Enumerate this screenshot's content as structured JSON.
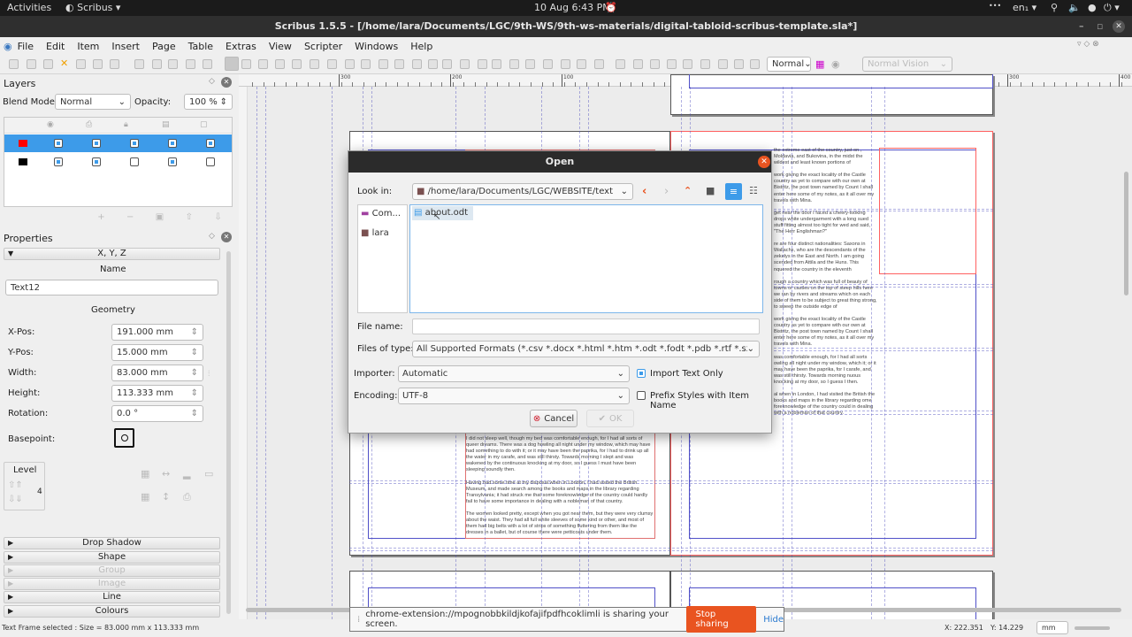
{
  "topbar": {
    "activities": "Activities",
    "app": "Scribus",
    "app_arrow": "▾",
    "clock": "10 Aug  6:43 PM",
    "alarm_icon": "alarm-clock-icon",
    "dots": "•••",
    "lang": "en₁ ▾",
    "tray_icons": [
      "network-icon",
      "volume-icon",
      "microphone-icon",
      "power-icon"
    ]
  },
  "window": {
    "title": "Scribus 1.5.5 - [/home/lara/Documents/LGC/9th-WS/9th-ws-materials/digital-tabloid-scribus-template.sla*]"
  },
  "menu": [
    "File",
    "Edit",
    "Item",
    "Insert",
    "Page",
    "Table",
    "Extras",
    "View",
    "Scripter",
    "Windows",
    "Help"
  ],
  "toolbar": {
    "mode": "Normal",
    "vision": "Normal Vision"
  },
  "ruler": {
    "labels": [
      "300",
      "200",
      "100",
      "0",
      "100",
      "200",
      "300",
      "400"
    ]
  },
  "layers": {
    "title": "Layers",
    "blend_label": "Blend Mode:",
    "blend_value": "Normal",
    "opacity_label": "Opacity:",
    "opacity_value": "100 %",
    "rows": [
      {
        "color": "#ff0000",
        "checks": [
          true,
          true,
          true,
          true,
          true
        ],
        "selected": true
      },
      {
        "color": "#000000",
        "checks": [
          true,
          true,
          false,
          true,
          false
        ],
        "selected": false
      }
    ]
  },
  "properties": {
    "title": "Properties",
    "xyz": "X, Y, Z",
    "name_heading": "Name",
    "name_value": "Text12",
    "geometry": "Geometry",
    "fields": [
      {
        "label": "X-Pos:",
        "value": "191.000 mm"
      },
      {
        "label": "Y-Pos:",
        "value": "15.000 mm"
      },
      {
        "label": "Width:",
        "value": "83.000 mm"
      },
      {
        "label": "Height:",
        "value": "113.333 mm"
      },
      {
        "label": "Rotation:",
        "value": "0.0 °"
      }
    ],
    "basepoint": "Basepoint:",
    "level": "Level",
    "level_value": "4",
    "sections": [
      {
        "label": "Drop Shadow",
        "enabled": true
      },
      {
        "label": "Shape",
        "enabled": true
      },
      {
        "label": "Group",
        "enabled": false
      },
      {
        "label": "Image",
        "enabled": false
      },
      {
        "label": "Line",
        "enabled": true
      },
      {
        "label": "Colours",
        "enabled": true
      }
    ]
  },
  "document": {
    "left_text": [
      "I did not sleep well, though my bed was comfortable enough, for I had all sorts of queer dreams. There was a dog howling all night under my window, which may have had something to do with it; or it may have been the paprika, for I had to drink up all the water in my carafe, and was still thirsty. Towards morning I slept and was wakened by the continuous knocking at my door, so I guess I must have been sleeping soundly then.",
      "Having had some time at my disposal when in London, I had visited the British Museum, and made search among the books and maps in the library regarding Transylvania; it had struck me that some foreknowledge of the country could hardly fail to have some importance in dealing with a nobleman of that country.",
      "The women looked pretty, except when you got near them, but they were very clumsy about the waist. They had all full white sleeves of some kind or other, and most of them had big belts with a lot of strips of something fluttering from them like the dresses in a ballet, but of course there were petticoats under them."
    ],
    "right_text": [
      "the extreme east of the country, just on , Moldavia, and Bukovina, in the midst the wildest and least known portions of",
      "work giving the exact locality of the Castle country as yet to compare with our own at Bistritz, the post town named by Count I shall enter here some of my notes, as it all over my travels with Mina.",
      "get near the door I faced a cheery-looking drops white undergarment with a long sued stuff fitting almost too tight for wed and said, \"The Herr Englishman?\"",
      "re are four distinct nationalities: Saxons in Wallachs, who are the descendants of the zekelys in the East and North. I am going scended from Attila and the Huns. This nquered the country in the eleventh",
      "rough a country which was full of beauty of towns or castles on the top of steep hills here we ran by rivers and streams which on each side of them to be subject to great thing strong, to sweep the outside edge of",
      "work giving the exact locality of the Castle country as yet to compare with our own at Bistritz, the post town named by Count I shall enter here some of my notes, as it all over my travels with Mina.",
      "was comfortable enough, for I had all sorts owling all night under my window, which it; or it may have been the paprika, for I carafe, and was still thirsty. Towards morning nuous knocking at my door, so I guess I then.",
      "al when in London, I had visited the British the books and maps in the library regarding ome foreknowledge of the country could in dealing with a nobleman of that country."
    ]
  },
  "dialog": {
    "title": "Open",
    "look_in_label": "Look in:",
    "look_in_value": "/home/lara/Documents/LGC/WEBSITE/text",
    "places": [
      {
        "label": "Com...",
        "icon": "computer-icon"
      },
      {
        "label": "lara",
        "icon": "folder-icon"
      }
    ],
    "files": [
      {
        "name": "about.odt",
        "icon": "document-icon"
      }
    ],
    "file_name_label": "File name:",
    "file_name_value": "",
    "types_label": "Files of type:",
    "types_value": "All Supported Formats (*.csv *.docx *.html *.htm *.odt *.fodt *.pdb *.rtf *.sxw *.txt *",
    "importer_label": "Importer:",
    "importer_value": "Automatic",
    "import_text_only": "Import Text Only",
    "import_text_only_checked": true,
    "encoding_label": "Encoding:",
    "encoding_value": "UTF-8",
    "prefix_styles": "Prefix Styles with Item Name",
    "prefix_styles_checked": false,
    "cancel": "Cancel",
    "ok": "OK"
  },
  "share": {
    "message": "chrome-extension://mpognobbkildjkofajifpdfhcoklimli is sharing your screen.",
    "stop": "Stop sharing",
    "hide": "Hide"
  },
  "status": {
    "selection": "Text Frame selected : Size = 83.000 mm x 113.333 mm",
    "x": "X: 222.351",
    "y": "Y: 14.229",
    "unit": "mm"
  },
  "colors": {
    "accent": "#3d9be9",
    "stop_sharing": "#e95420",
    "selected_frame": "#ff6060"
  }
}
